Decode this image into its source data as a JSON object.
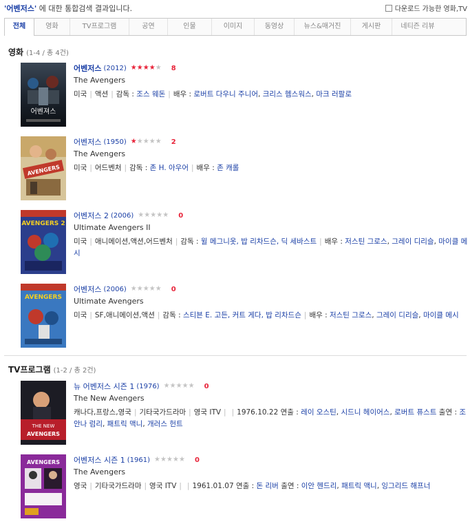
{
  "header": {
    "query": "'어벤저스'",
    "query_suffix": " 에 대한 통합검색 결과입니다.",
    "download_option": "다운로드 가능한 영화,TV"
  },
  "tabs": [
    {
      "label": "전체",
      "active": true
    },
    {
      "label": "영화",
      "active": false
    },
    {
      "label": "TV프로그램",
      "active": false
    },
    {
      "label": "공연",
      "active": false
    },
    {
      "label": "인물",
      "active": false
    },
    {
      "label": "이미지",
      "active": false
    },
    {
      "label": "동영상",
      "active": false
    },
    {
      "label": "뉴스&매거진",
      "active": false
    },
    {
      "label": "게시판",
      "active": false
    },
    {
      "label": "네티즌 리뷰",
      "active": false
    }
  ],
  "movies": {
    "title": "영화",
    "count": "(1-4 / 총 4건)",
    "items": [
      {
        "title": "어벤저스",
        "year": "(2012)",
        "rating": 4,
        "score": "8",
        "original": "The Avengers",
        "country": "미국",
        "genre": "액션",
        "director_label": "감독 :",
        "director": "조스 웨돈",
        "cast_label": "배우 :",
        "cast": [
          "로버트 다우니 주니어",
          "크리스 헴스워스",
          "마크 러팔로"
        ]
      },
      {
        "title": "어벤저스",
        "year": "(1950)",
        "rating": 1,
        "score": "2",
        "original": "The Avengers",
        "country": "미국",
        "genre": "어드벤처",
        "director_label": "감독 :",
        "director": "존 H. 아우어",
        "cast_label": "배우 :",
        "cast": [
          "존 캐롤"
        ]
      },
      {
        "title": "어벤저스 2",
        "year": "(2006)",
        "rating": 0,
        "score": "0",
        "original": "Ultimate Avengers II",
        "country": "미국",
        "genre": "애니메이션,액션,어드벤처",
        "director_label": "감독 :",
        "director": "윌 메그니옷, 밥 리차드슨, 딕 세바스트",
        "cast_label": "배우 :",
        "cast": [
          "저스틴 그로스",
          "그레이 디리슬",
          "마이클 메시"
        ]
      },
      {
        "title": "어벤저스",
        "year": "(2006)",
        "rating": 0,
        "score": "0",
        "original": "Ultimate Avengers",
        "country": "미국",
        "genre": "SF,애니메이션,액션",
        "director_label": "감독 :",
        "director": "스티븐 E. 고든, 커트 게다, 밥 리차드슨",
        "cast_label": "배우 :",
        "cast": [
          "저스틴 그로스",
          "그레이 디리슬",
          "마이클 메시"
        ]
      }
    ]
  },
  "tv": {
    "title": "TV프로그램",
    "count": "(1-2 / 총 2건)",
    "items": [
      {
        "title": "뉴 어벤저스 시즌 1",
        "year": "(1976)",
        "rating": 0,
        "score": "0",
        "original": "The New Avengers",
        "country": "캐나다,프랑스,영국",
        "genre": "기타국가드라마",
        "channel": "영국 ITV",
        "air": "1976.10.22",
        "cast_label": "연출 :",
        "cast": [
          "레이 오스틴",
          "시드니 헤이어스",
          "로버트 퓨스트"
        ],
        "cast2_label": "출연 :",
        "cast2": [
          "조안나 럼리",
          "패트릭 맥니",
          "개러스 헌트"
        ]
      },
      {
        "title": "어벤저스 시즌 1",
        "year": "(1961)",
        "rating": 0,
        "score": "0",
        "original": "The Avengers",
        "country": "영국",
        "genre": "기타국가드라마",
        "channel": "영국 ITV",
        "air": "1961.01.07",
        "cast_label": "연출 :",
        "cast": [
          "돈 리버"
        ],
        "cast2_label": "출연 :",
        "cast2": [
          "이안 헨드리",
          "패트릭 맥니",
          "잉그리드 해프너"
        ]
      }
    ]
  }
}
